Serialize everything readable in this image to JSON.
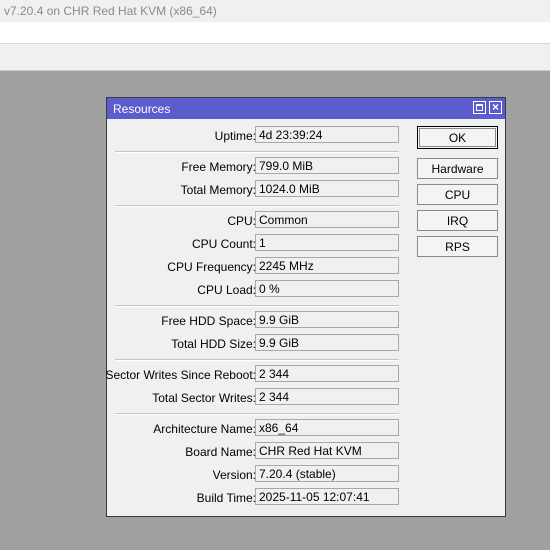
{
  "app": {
    "version_title": "v7.20.4 on CHR Red Hat KVM (x86_64)"
  },
  "window": {
    "title": "Resources",
    "close_glyph": "×"
  },
  "fields": [
    {
      "label": "Uptime:",
      "value": "4d 23:39:24"
    },
    {
      "label": "Free Memory:",
      "value": "799.0 MiB"
    },
    {
      "label": "Total Memory:",
      "value": "1024.0 MiB"
    },
    {
      "label": "CPU:",
      "value": "Common"
    },
    {
      "label": "CPU Count:",
      "value": "1"
    },
    {
      "label": "CPU Frequency:",
      "value": "2245 MHz"
    },
    {
      "label": "CPU Load:",
      "value": "0 %"
    },
    {
      "label": "Free HDD Space:",
      "value": "9.9 GiB"
    },
    {
      "label": "Total HDD Size:",
      "value": "9.9 GiB"
    },
    {
      "label": "Sector Writes Since Reboot:",
      "value": "2 344"
    },
    {
      "label": "Total Sector Writes:",
      "value": "2 344"
    },
    {
      "label": "Architecture Name:",
      "value": "x86_64"
    },
    {
      "label": "Board Name:",
      "value": "CHR Red Hat KVM"
    },
    {
      "label": "Version:",
      "value": "7.20.4 (stable)"
    },
    {
      "label": "Build Time:",
      "value": "2025-11-05 12:07:41"
    }
  ],
  "buttons": {
    "ok": "OK",
    "hardware": "Hardware",
    "cpu": "CPU",
    "irq": "IRQ",
    "rps": "RPS"
  },
  "colors": {
    "titlebar": "#5c5cce",
    "desktop": "#a0a0a0",
    "window": "#f0f0f0"
  }
}
